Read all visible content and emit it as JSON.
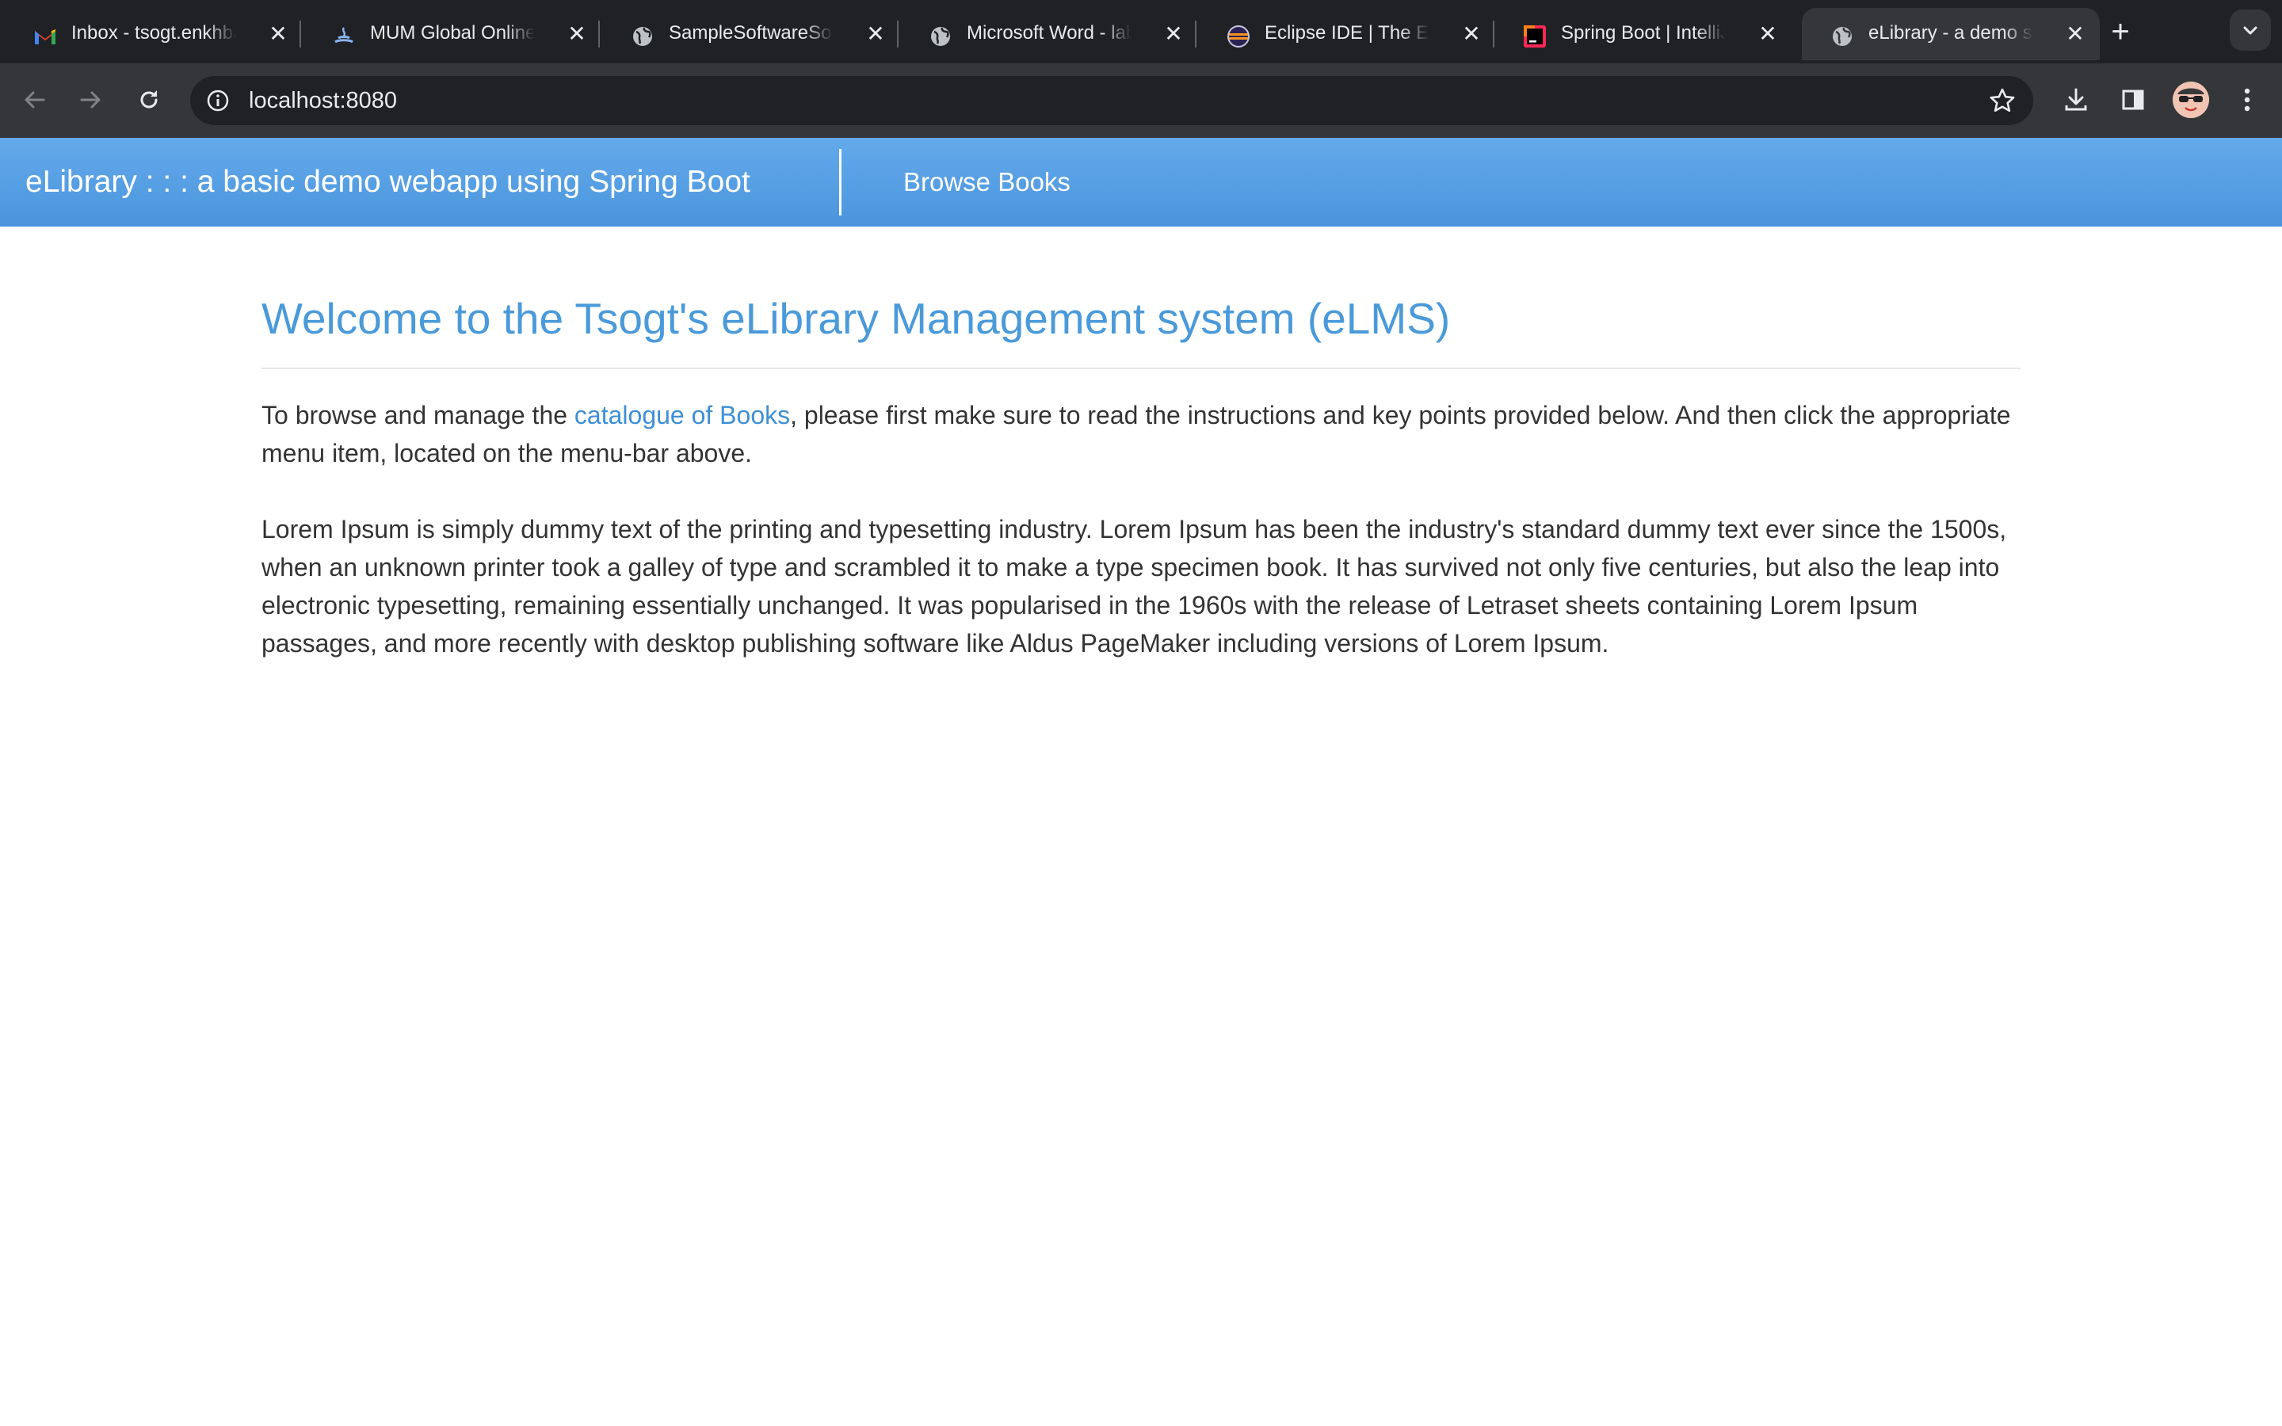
{
  "browser": {
    "tabs": [
      {
        "title": "Inbox - tsogt.enkhbayar",
        "icon": "gmail-icon",
        "active": false
      },
      {
        "title": "MUM Global Online E",
        "icon": "mum-icon",
        "active": false
      },
      {
        "title": "SampleSoftwareSolution",
        "icon": "globe-icon",
        "active": false
      },
      {
        "title": "Microsoft Word - lab",
        "icon": "globe-icon",
        "active": false
      },
      {
        "title": "Eclipse IDE | The Eclipse",
        "icon": "eclipse-icon",
        "active": false
      },
      {
        "title": "Spring Boot | IntelliJ",
        "icon": "intellij-icon",
        "active": false
      },
      {
        "title": "eLibrary - a demo spring",
        "icon": "globe-icon",
        "active": true
      }
    ],
    "close_glyph": "✕",
    "new_tab_glyph": "+",
    "url": "localhost:8080",
    "colors": {
      "tabstrip": "#202124",
      "toolbar": "#35363a",
      "omnibox": "#202124",
      "text": "#e8eaed"
    }
  },
  "navbar": {
    "brand": "eLibrary : : : a basic demo webapp using Spring Boot",
    "links": [
      {
        "label": "Browse Books"
      }
    ],
    "colors": {
      "gradient_top": "#64aaea",
      "gradient_bottom": "#4a95dd"
    }
  },
  "main": {
    "title": "Welcome to the Tsogt's eLibrary Management system (eLMS)",
    "intro_before_link": "To browse and manage the ",
    "intro_link": "catalogue of Books",
    "intro_after_link": ", please first make sure to read the instructions and key points provided below. And then click the appropriate menu item, located on the menu-bar above.",
    "lorem": "Lorem Ipsum is simply dummy text of the printing and typesetting industry. Lorem Ipsum has been the industry's standard dummy text ever since the 1500s, when an unknown printer took a galley of type and scrambled it to make a type specimen book. It has survived not only five centuries, but also the leap into electronic typesetting, remaining essentially unchanged. It was popularised in the 1960s with the release of Letraset sheets containing Lorem Ipsum passages, and more recently with desktop publishing software like Aldus PageMaker including versions of Lorem Ipsum.",
    "colors": {
      "title": "#4a9ada",
      "link": "#3d8fd6",
      "body_text": "#333333"
    }
  }
}
